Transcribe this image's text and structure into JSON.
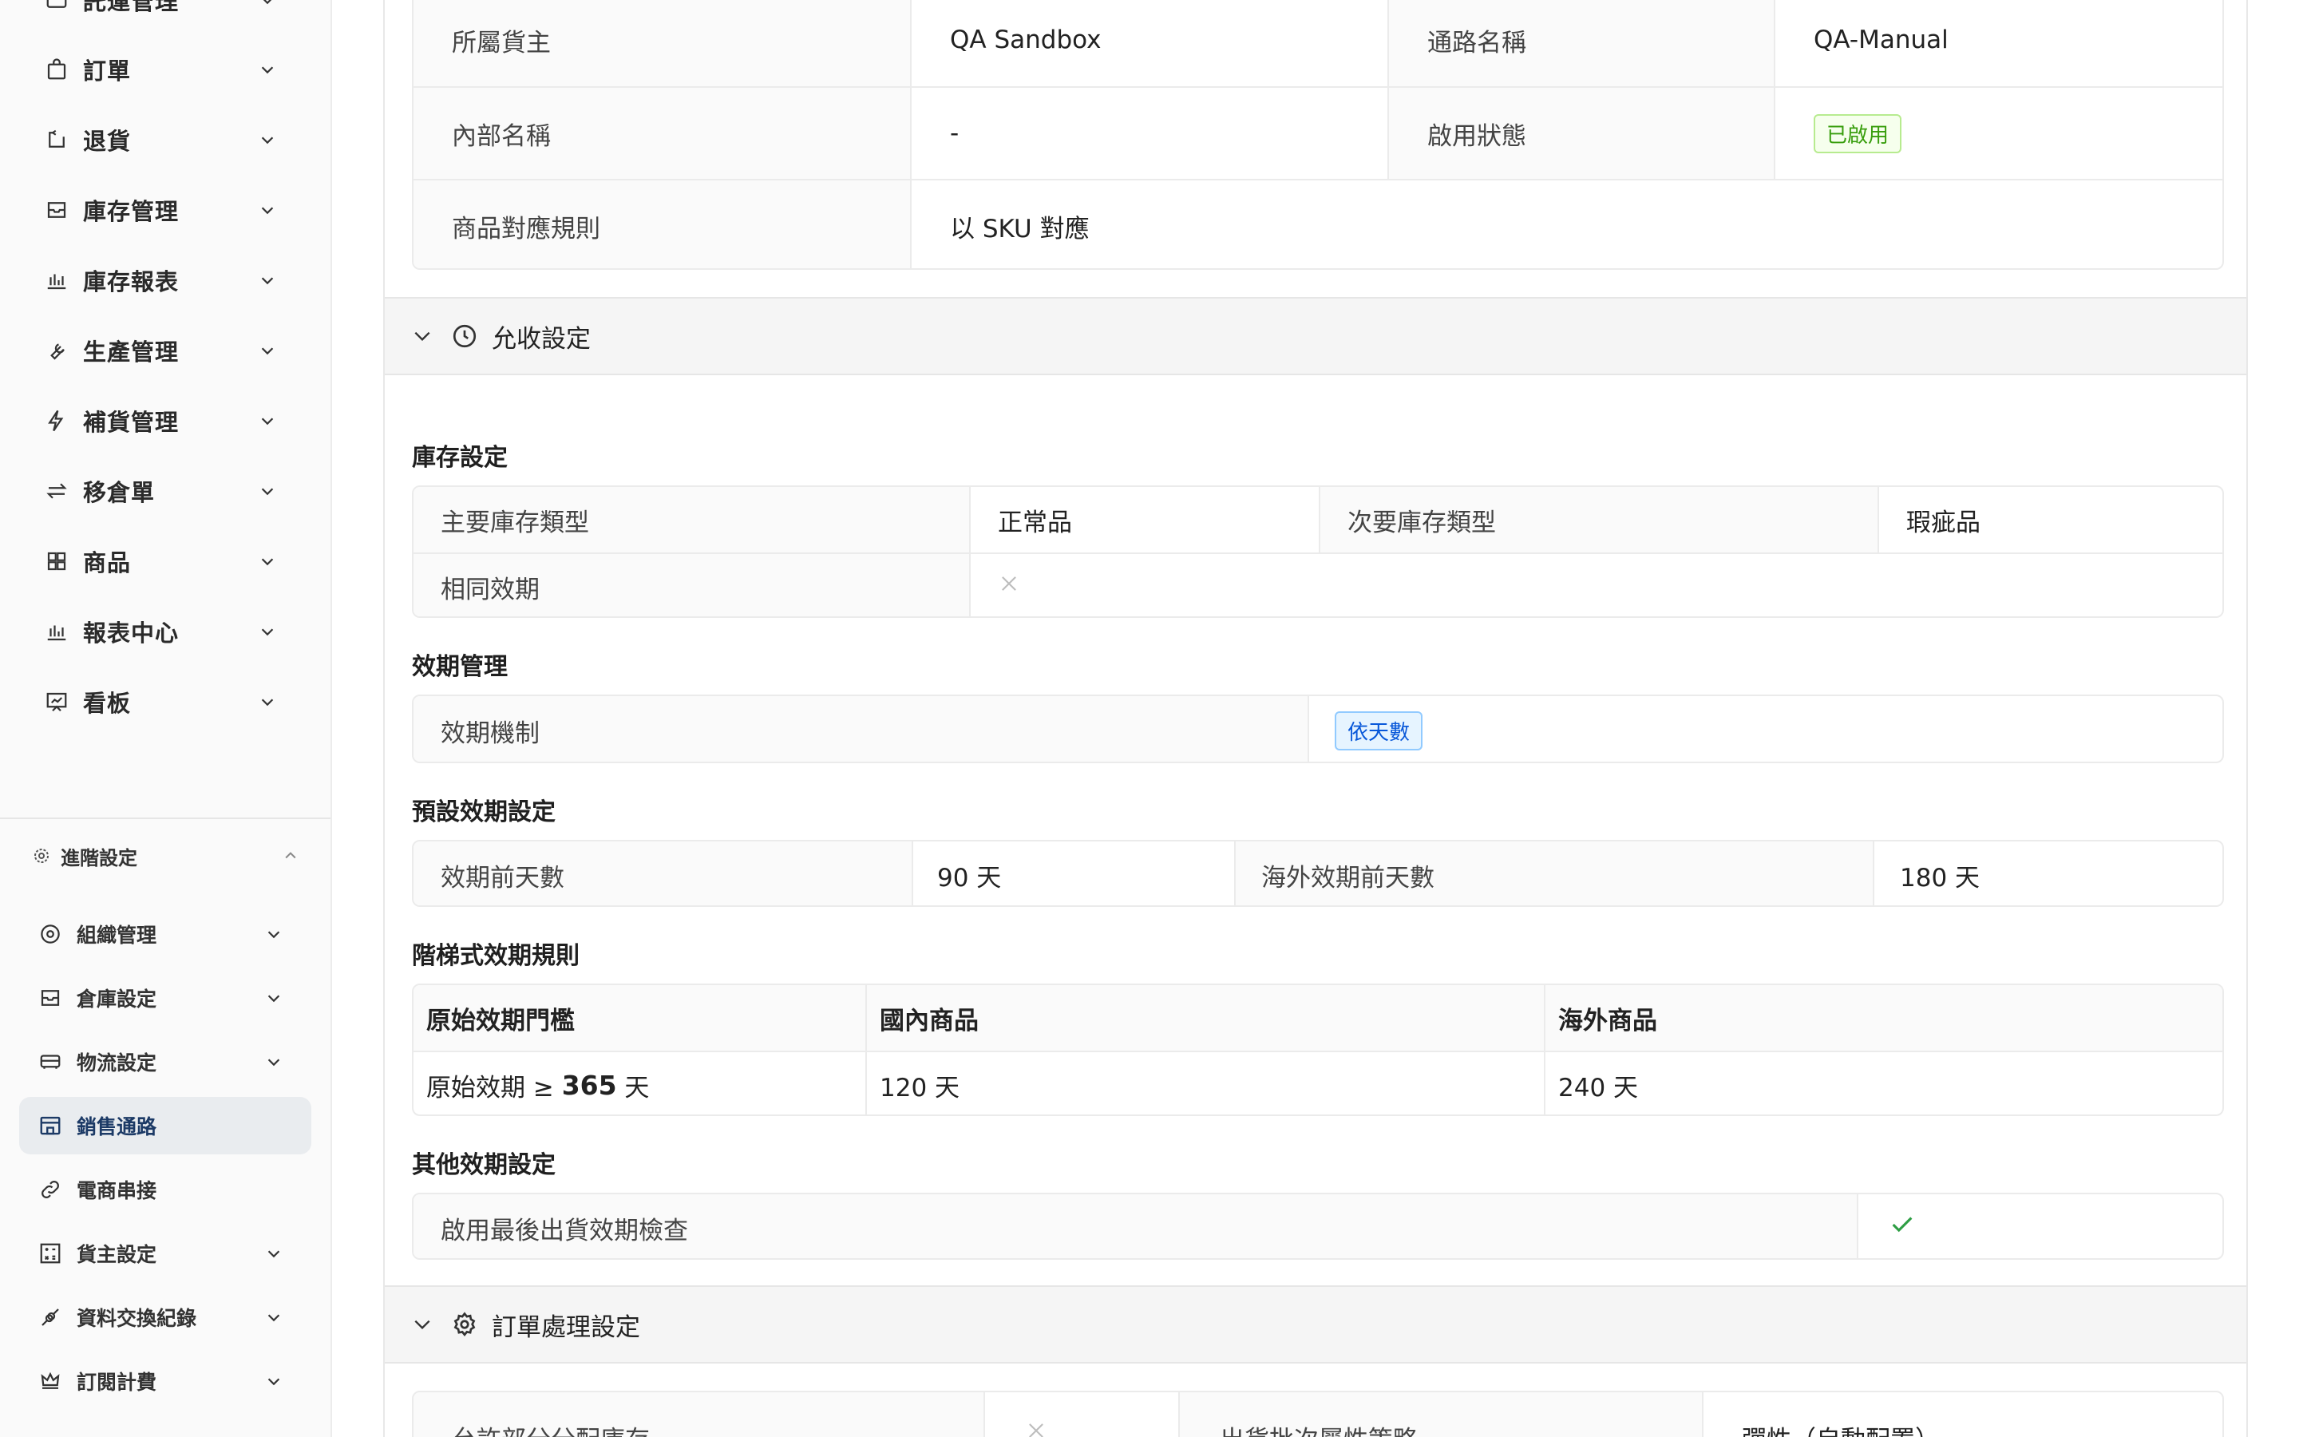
{
  "sidebar": {
    "top_items": [
      {
        "label": "託運管理",
        "icon": "truck-icon"
      },
      {
        "label": "訂單",
        "icon": "bag-icon"
      },
      {
        "label": "退貨",
        "icon": "return-icon"
      },
      {
        "label": "庫存管理",
        "icon": "inbox-icon"
      },
      {
        "label": "庫存報表",
        "icon": "bar-chart-icon"
      },
      {
        "label": "生產管理",
        "icon": "wrench-icon"
      },
      {
        "label": "補貨管理",
        "icon": "lightning-icon"
      },
      {
        "label": "移倉單",
        "icon": "swap-icon"
      },
      {
        "label": "商品",
        "icon": "grid-icon"
      },
      {
        "label": "報表中心",
        "icon": "bar-chart-icon"
      },
      {
        "label": "看板",
        "icon": "dashboard-icon"
      }
    ],
    "advanced_section": {
      "label": "進階設定",
      "icon": "gear-icon"
    },
    "advanced_items": [
      {
        "label": "組織管理",
        "icon": "gear-icon",
        "has_chevron": true
      },
      {
        "label": "倉庫設定",
        "icon": "inbox-icon",
        "has_chevron": true
      },
      {
        "label": "物流設定",
        "icon": "truck-icon",
        "has_chevron": true
      },
      {
        "label": "銷售通路",
        "icon": "shop-icon",
        "has_chevron": false,
        "active": true
      },
      {
        "label": "電商串接",
        "icon": "link-icon",
        "has_chevron": false
      },
      {
        "label": "貨主設定",
        "icon": "calculator-icon",
        "has_chevron": true
      },
      {
        "label": "資料交換紀錄",
        "icon": "api-icon",
        "has_chevron": true
      },
      {
        "label": "訂閱計費",
        "icon": "crown-icon",
        "has_chevron": true
      }
    ]
  },
  "basic_info": {
    "owner_label": "所屬貨主",
    "owner_value": "QA Sandbox",
    "channel_label": "通路名稱",
    "channel_value": "QA-Manual",
    "internal_label": "內部名稱",
    "internal_value": "-",
    "status_label": "啟用狀態",
    "status_value": "已啟用",
    "mapping_label": "商品對應規則",
    "mapping_value": "以 SKU 對應"
  },
  "acceptance_panel": {
    "title": "允收設定",
    "inventory": {
      "title": "庫存設定",
      "primary_label": "主要庫存類型",
      "primary_value": "正常品",
      "secondary_label": "次要庫存類型",
      "secondary_value": "瑕疵品",
      "same_expiry_label": "相同效期"
    },
    "expiry_mgmt": {
      "title": "效期管理",
      "mechanism_label": "效期機制",
      "mechanism_value": "依天數"
    },
    "default_expiry": {
      "title": "預設效期設定",
      "days_label": "效期前天數",
      "days_value": "90 天",
      "overseas_label": "海外效期前天數",
      "overseas_value": "180 天"
    },
    "tiered": {
      "title": "階梯式效期規則",
      "headers": [
        "原始效期門檻",
        "國內商品",
        "海外商品"
      ],
      "row": {
        "prefix": "原始效期 ≥ ",
        "threshold": "365",
        "suffix": " 天",
        "domestic": "120 天",
        "overseas": "240 天"
      }
    },
    "other": {
      "title": "其他效期設定",
      "last_check_label": "啟用最後出貨效期檢查"
    }
  },
  "order_panel": {
    "title": "訂單處理設定",
    "partial_label": "允許部分分配庫存",
    "strategy_label": "出貨批次屬性策略",
    "strategy_value": "彈性（自動配置）"
  },
  "colors": {
    "active_nav": "#e9ecef",
    "success": "#389e0d",
    "link_blue": "#0958d9",
    "check": "#2e9e44"
  }
}
